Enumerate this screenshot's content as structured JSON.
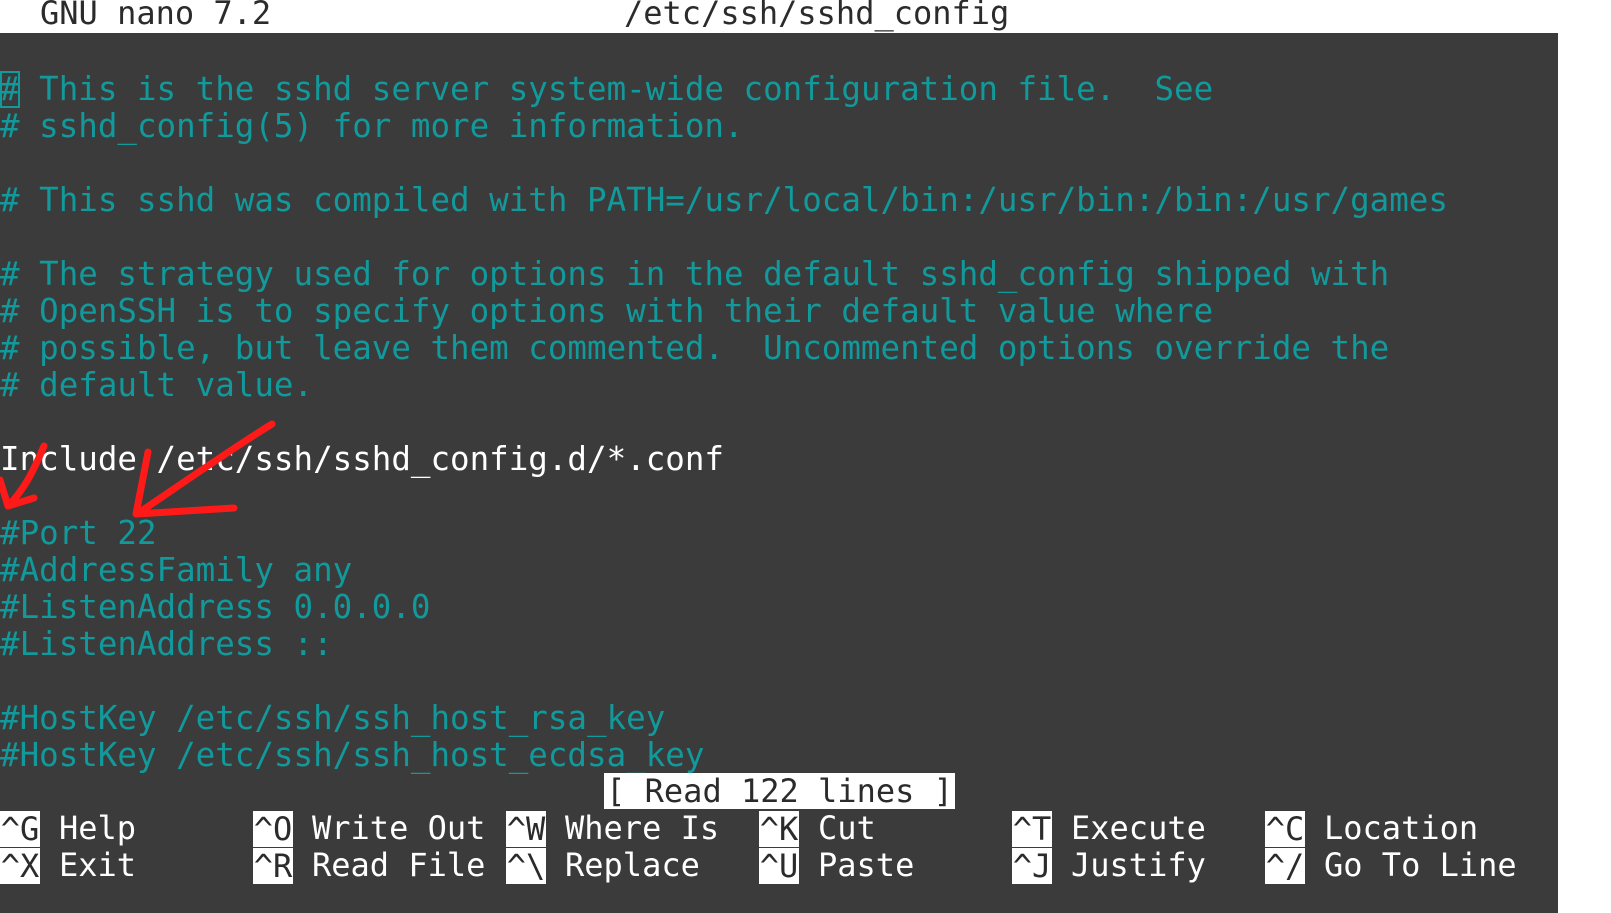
{
  "title_bar": {
    "app": "GNU nano 7.2",
    "file": "/etc/ssh/sshd_config"
  },
  "editor": {
    "lines": [
      {
        "row": 2,
        "text": "# This is the sshd server system-wide configuration file.  See",
        "style": "comment",
        "cursor": true
      },
      {
        "row": 3,
        "text": "# sshd_config(5) for more information.",
        "style": "comment"
      },
      {
        "row": 5,
        "text": "# This sshd was compiled with PATH=/usr/local/bin:/usr/bin:/bin:/usr/games",
        "style": "comment"
      },
      {
        "row": 7,
        "text": "# The strategy used for options in the default sshd_config shipped with",
        "style": "comment"
      },
      {
        "row": 8,
        "text": "# OpenSSH is to specify options with their default value where",
        "style": "comment"
      },
      {
        "row": 9,
        "text": "# possible, but leave them commented.  Uncommented options override the",
        "style": "comment"
      },
      {
        "row": 10,
        "text": "# default value.",
        "style": "comment"
      },
      {
        "row": 12,
        "text": "Include /etc/ssh/sshd_config.d/*.conf",
        "style": "plain"
      },
      {
        "row": 14,
        "text": "#Port 22",
        "style": "comment"
      },
      {
        "row": 15,
        "text": "#AddressFamily any",
        "style": "comment"
      },
      {
        "row": 16,
        "text": "#ListenAddress 0.0.0.0",
        "style": "comment"
      },
      {
        "row": 17,
        "text": "#ListenAddress ::",
        "style": "comment"
      },
      {
        "row": 19,
        "text": "#HostKey /etc/ssh/ssh_host_rsa_key",
        "style": "comment"
      },
      {
        "row": 20,
        "text": "#HostKey /etc/ssh/ssh_host_ecdsa_key",
        "style": "comment"
      }
    ]
  },
  "status_message": "[ Read 122 lines ]",
  "shortcuts": {
    "row1": [
      {
        "key": "^G",
        "label": "Help"
      },
      {
        "key": "^O",
        "label": "Write Out"
      },
      {
        "key": "^W",
        "label": "Where Is"
      },
      {
        "key": "^K",
        "label": "Cut"
      },
      {
        "key": "^T",
        "label": "Execute"
      },
      {
        "key": "^C",
        "label": "Location"
      }
    ],
    "row2": [
      {
        "key": "^X",
        "label": "Exit"
      },
      {
        "key": "^R",
        "label": "Read File"
      },
      {
        "key": "^\\",
        "label": "Replace"
      },
      {
        "key": "^U",
        "label": "Paste"
      },
      {
        "key": "^J",
        "label": "Justify"
      },
      {
        "key": "^/",
        "label": "Go To Line"
      }
    ]
  },
  "colors": {
    "background": "#3b3b3b",
    "comment": "#12999b",
    "plain_text": "#ffffff",
    "bar": "#ffffff",
    "annotation": "#ff0000"
  },
  "annotations": {
    "arrows": [
      "red-arrow",
      "red-arrow"
    ]
  }
}
